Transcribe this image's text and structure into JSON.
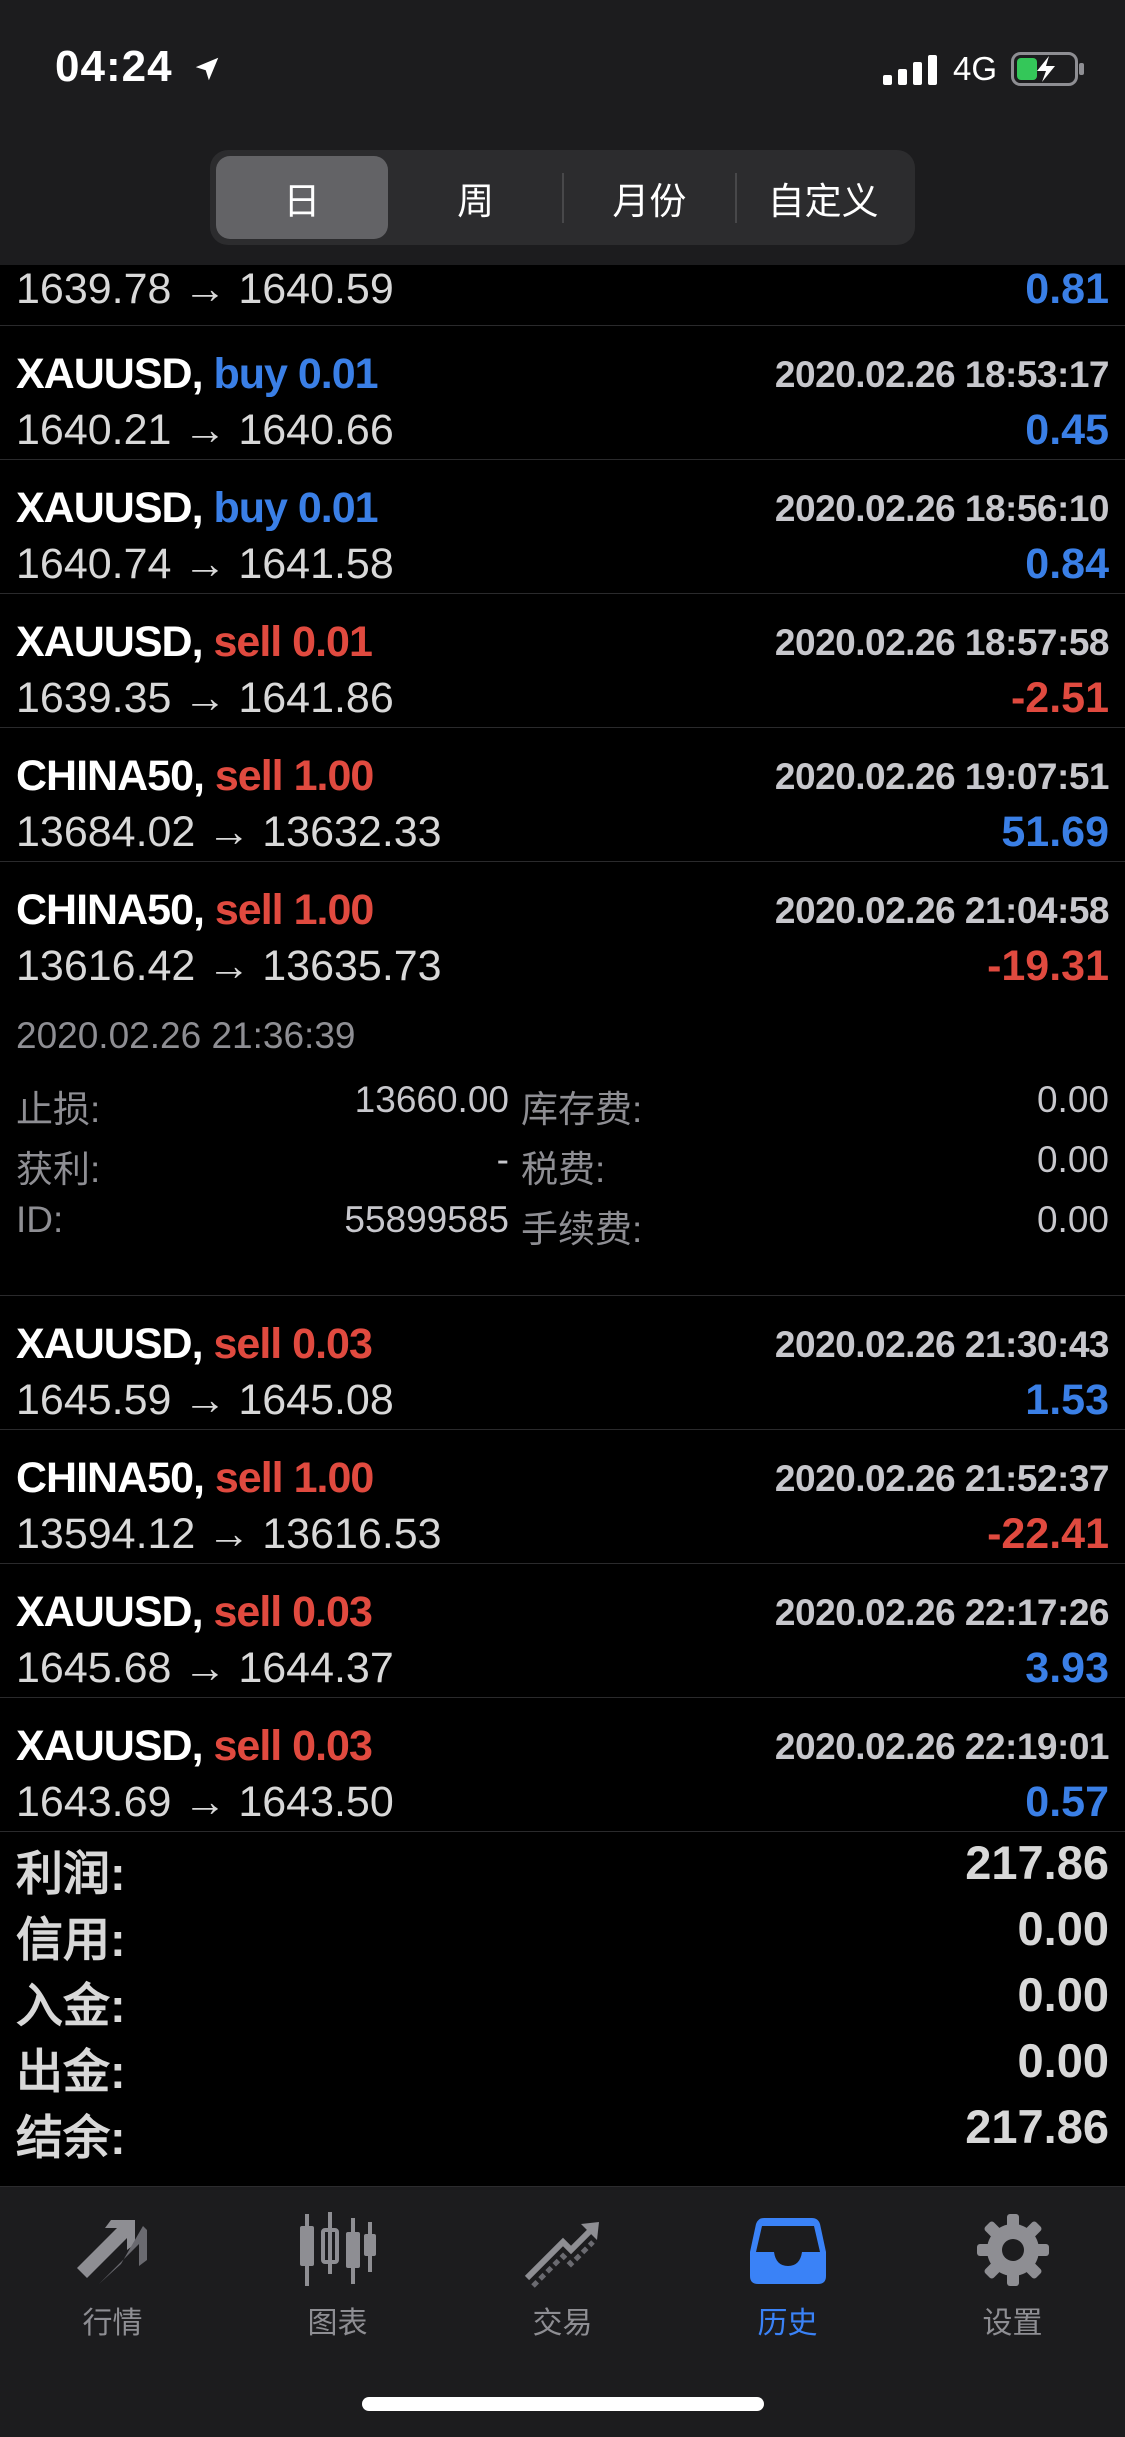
{
  "status": {
    "time": "04:24",
    "network": "4G"
  },
  "tabs_period": [
    {
      "label": "日",
      "active": true
    },
    {
      "label": "周",
      "active": false
    },
    {
      "label": "月份",
      "active": false
    },
    {
      "label": "自定义",
      "active": false
    }
  ],
  "partial_row": {
    "prices": "1639.78 → 1640.59",
    "profit": "0.81"
  },
  "trades": [
    {
      "symbol": "XAUUSD,",
      "side": "buy",
      "volume": "0.01",
      "time": "2020.02.26 18:53:17",
      "prices": "1640.21 → 1640.66",
      "profit": "0.45"
    },
    {
      "symbol": "XAUUSD,",
      "side": "buy",
      "volume": "0.01",
      "time": "2020.02.26 18:56:10",
      "prices": "1640.74 → 1641.58",
      "profit": "0.84"
    },
    {
      "symbol": "XAUUSD,",
      "side": "sell",
      "volume": "0.01",
      "time": "2020.02.26 18:57:58",
      "prices": "1639.35 → 1641.86",
      "profit": "-2.51"
    },
    {
      "symbol": "CHINA50,",
      "side": "sell",
      "volume": "1.00",
      "time": "2020.02.26 19:07:51",
      "prices": "13684.02 → 13632.33",
      "profit": "51.69"
    },
    {
      "symbol": "CHINA50,",
      "side": "sell",
      "volume": "1.00",
      "time": "2020.02.26 21:04:58",
      "prices": "13616.42 → 13635.73",
      "profit": "-19.31"
    }
  ],
  "details": {
    "close_time": "2020.02.26 21:36:39",
    "sl_label": "止损:",
    "sl_value": "13660.00",
    "swap_label": "库存费:",
    "swap_value": "0.00",
    "tp_label": "获利:",
    "tp_value": "-",
    "tax_label": "税费:",
    "tax_value": "0.00",
    "id_label": "ID:",
    "id_value": "55899585",
    "fee_label": "手续费:",
    "fee_value": "0.00"
  },
  "trades2": [
    {
      "symbol": "XAUUSD,",
      "side": "sell",
      "volume": "0.03",
      "time": "2020.02.26 21:30:43",
      "prices": "1645.59 → 1645.08",
      "profit": "1.53"
    },
    {
      "symbol": "CHINA50,",
      "side": "sell",
      "volume": "1.00",
      "time": "2020.02.26 21:52:37",
      "prices": "13594.12 → 13616.53",
      "profit": "-22.41"
    },
    {
      "symbol": "XAUUSD,",
      "side": "sell",
      "volume": "0.03",
      "time": "2020.02.26 22:17:26",
      "prices": "1645.68 → 1644.37",
      "profit": "3.93"
    },
    {
      "symbol": "XAUUSD,",
      "side": "sell",
      "volume": "0.03",
      "time": "2020.02.26 22:19:01",
      "prices": "1643.69 → 1643.50",
      "profit": "0.57"
    }
  ],
  "summary": [
    {
      "label": "利润:",
      "value": "217.86"
    },
    {
      "label": "信用:",
      "value": "0.00"
    },
    {
      "label": "入金:",
      "value": "0.00"
    },
    {
      "label": "出金:",
      "value": "0.00"
    },
    {
      "label": "结余:",
      "value": "217.86"
    }
  ],
  "bottom_tabs": [
    {
      "label": "行情",
      "icon": "quotes-icon",
      "active": false
    },
    {
      "label": "图表",
      "icon": "chart-icon",
      "active": false
    },
    {
      "label": "交易",
      "icon": "trade-icon",
      "active": false
    },
    {
      "label": "历史",
      "icon": "history-icon",
      "active": true
    },
    {
      "label": "设置",
      "icon": "settings-icon",
      "active": false
    }
  ],
  "colors": {
    "buy": "#3a7fe6",
    "sell": "#e04a3f",
    "active_tab": "#3a82f7"
  }
}
